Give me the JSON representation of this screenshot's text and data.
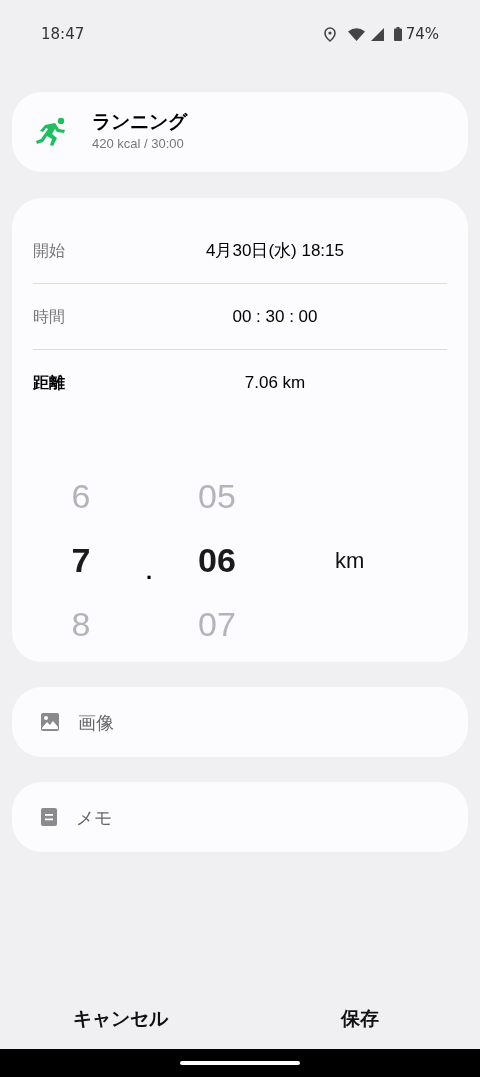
{
  "status_bar": {
    "time": "18:47",
    "battery": "74%"
  },
  "activity": {
    "title": "ランニング",
    "subtitle": "420 kcal / 30:00"
  },
  "fields": [
    {
      "label": "開始",
      "value": "4月30日(水) 18:15",
      "selected": false
    },
    {
      "label": "時間",
      "value": "00 : 30 : 00",
      "selected": false
    },
    {
      "label": "距離",
      "value": "7.06 km",
      "selected": true
    }
  ],
  "picker": {
    "columns": [
      {
        "items": [
          {
            "text": "6",
            "selected": false
          },
          {
            "text": "7",
            "selected": true
          },
          {
            "text": "8",
            "selected": false
          }
        ]
      },
      {
        "items": [
          {
            "text": "05",
            "selected": false
          },
          {
            "text": "06",
            "selected": true
          },
          {
            "text": "07",
            "selected": false
          }
        ]
      }
    ],
    "separator": ".",
    "unit": "km"
  },
  "attachments": [
    {
      "kind": "image",
      "label": "画像"
    },
    {
      "kind": "memo",
      "label": "メモ"
    }
  ],
  "buttons": [
    "キャンセル",
    "保存"
  ]
}
